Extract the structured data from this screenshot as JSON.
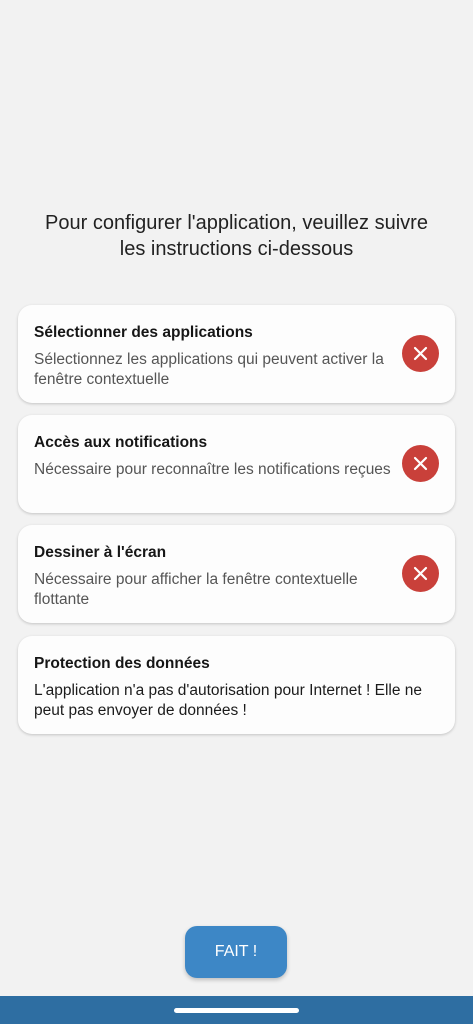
{
  "intro": {
    "text": "Pour configurer l'application, veuillez suivre les instructions ci-dessous"
  },
  "cards": [
    {
      "title": "Sélectionner des applications",
      "description": "Sélectionnez les applications qui peuvent activer la fenêtre contextuelle",
      "status": "not-granted",
      "status_icon": "close-icon",
      "status_color": "#c9403a"
    },
    {
      "title": "Accès aux notifications",
      "description": "Nécessaire pour reconnaître les notifications reçues",
      "status": "not-granted",
      "status_icon": "close-icon",
      "status_color": "#c9403a"
    },
    {
      "title": "Dessiner à l'écran",
      "description": "Nécessaire pour afficher la fenêtre contextuelle flottante",
      "status": "not-granted",
      "status_icon": "close-icon",
      "status_color": "#c9403a"
    },
    {
      "title": "Protection des données",
      "description": "L'application n'a pas d'autorisation pour Internet ! Elle ne peut pas envoyer de données !"
    }
  ],
  "done_button": {
    "label": "FAIT !",
    "color": "#3d87c6"
  },
  "nav_bar": {
    "color": "#2e6ea2"
  }
}
